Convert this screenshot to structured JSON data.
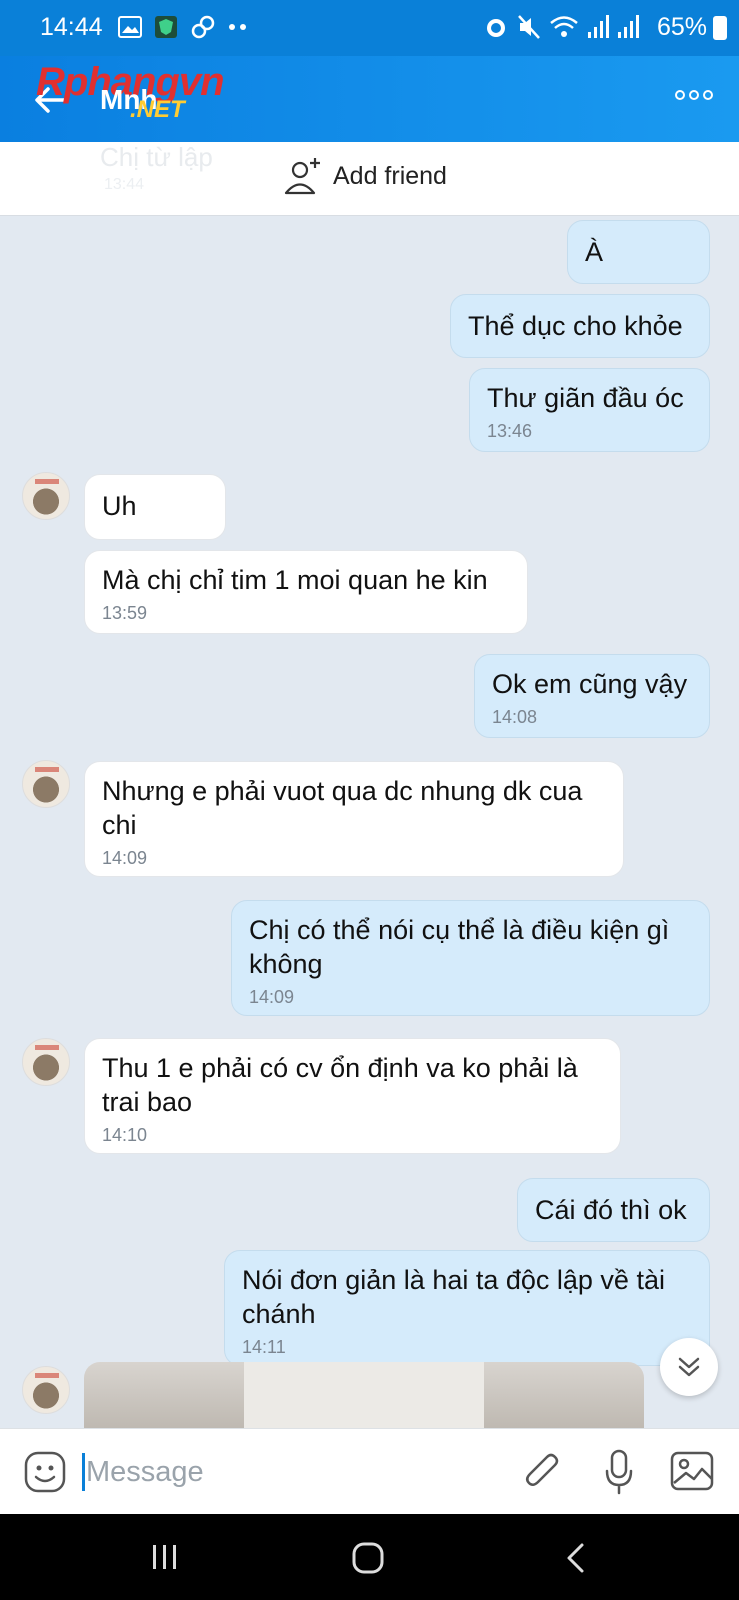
{
  "status_bar": {
    "time": "14:44",
    "battery": "65%",
    "icons_left": [
      "image-icon",
      "shield-app-icon",
      "link-icon",
      "more-dots-icon"
    ],
    "icons_right": [
      "alarm-icon",
      "mute-icon",
      "wifi-icon",
      "signal-icon",
      "signal-icon",
      "battery-icon"
    ]
  },
  "header": {
    "contact_name": "Mnh",
    "watermark_top": "Rphangvn",
    "watermark_bottom": ".NET"
  },
  "add_friend_bar": {
    "ghost_text": "Chị từ lập",
    "ghost_time": "13:44",
    "label": "Add friend"
  },
  "messages": [
    {
      "dir": "out",
      "text": "À",
      "time": ""
    },
    {
      "dir": "out",
      "text": "Thể dục cho khỏe",
      "time": ""
    },
    {
      "dir": "out",
      "text": "Thư giãn đầu óc",
      "time": "13:46"
    },
    {
      "dir": "in",
      "text": "Uh",
      "time": ""
    },
    {
      "dir": "in",
      "text": "Mà chị chỉ tim 1 moi quan he kin",
      "time": "13:59"
    },
    {
      "dir": "out",
      "text": "Ok em cũng vậy",
      "time": "14:08"
    },
    {
      "dir": "in",
      "text": "Nhưng e phải vuot qua dc nhung dk cua chi",
      "time": "14:09"
    },
    {
      "dir": "out",
      "text": "Chị có thể nói cụ thể là điều kiện gì không",
      "time": "14:09"
    },
    {
      "dir": "in",
      "text": "Thu 1 e phải có cv ổn định va ko phải là trai bao",
      "time": "14:10"
    },
    {
      "dir": "out",
      "text": "Cái đó thì ok",
      "time": ""
    },
    {
      "dir": "out",
      "text": "Nói đơn giản là hai ta độc lập về tài chánh",
      "time": "14:11"
    }
  ],
  "input_bar": {
    "placeholder": "Message"
  },
  "colors": {
    "header": "#0a80d8",
    "outgoing_bubble": "#d5ebfb",
    "incoming_bubble": "#ffffff",
    "chat_background": "#e2e9f1"
  }
}
